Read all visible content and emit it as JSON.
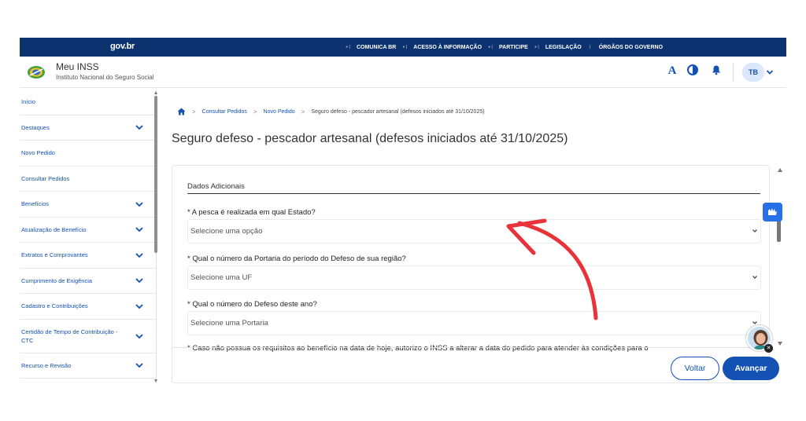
{
  "govbar": {
    "logo": "gov.br",
    "links": [
      "COMUNICA BR",
      "ACESSO À INFORMAÇÃO",
      "PARTICIPE",
      "LEGISLAÇÃO",
      "ÓRGÃOS DO GOVERNO"
    ]
  },
  "header": {
    "app_name": "Meu INSS",
    "app_subtitle": "Instituto Nacional do Seguro Social",
    "font_icon_label": "A",
    "avatar_initials": "TB"
  },
  "sidebar": {
    "items": [
      {
        "label": "Início"
      },
      {
        "label": "Destaques"
      },
      {
        "label": "Novo Pedido"
      },
      {
        "label": "Consultar Pedidos"
      },
      {
        "label": "Benefícios"
      },
      {
        "label": "Atualização de Benefício"
      },
      {
        "label": "Extratos e Comprovantes"
      },
      {
        "label": "Cumprimento de Exigência"
      },
      {
        "label": "Cadastro e Contribuições"
      },
      {
        "label": "Certidão de Tempo de Contribuição - CTC"
      },
      {
        "label": "Recurso e Revisão"
      }
    ]
  },
  "breadcrumb": {
    "items": [
      "Consultar Pedidos",
      "Novo Pedido"
    ],
    "current": "Seguro defeso - pescador artesanal (defesos iniciados até 31/10/2025)"
  },
  "page": {
    "title": "Seguro defeso - pescador artesanal (defesos iniciados até 31/10/2025)"
  },
  "form": {
    "section_title": "Dados Adicionais",
    "questions": [
      {
        "label": "* A pesca é realizada em qual Estado?",
        "value": "Selecione uma opção"
      },
      {
        "label": "* Qual o número da Portaria do período do Defeso de sua região?",
        "value": "Selecione uma UF"
      },
      {
        "label": "* Qual o número do Defeso deste ano?",
        "value": "Selecione uma Portaria"
      },
      {
        "label": "* Caso não possua os requisitos ao benefício na data de hoje, autorizo o INSS a alterar a data do pedido para atender às condições para o"
      }
    ]
  },
  "buttons": {
    "back": "Voltar",
    "next": "Avançar"
  },
  "colors": {
    "govbar": "#0c326f",
    "primary": "#1351b4",
    "annotation_arrow": "#e8333a"
  }
}
